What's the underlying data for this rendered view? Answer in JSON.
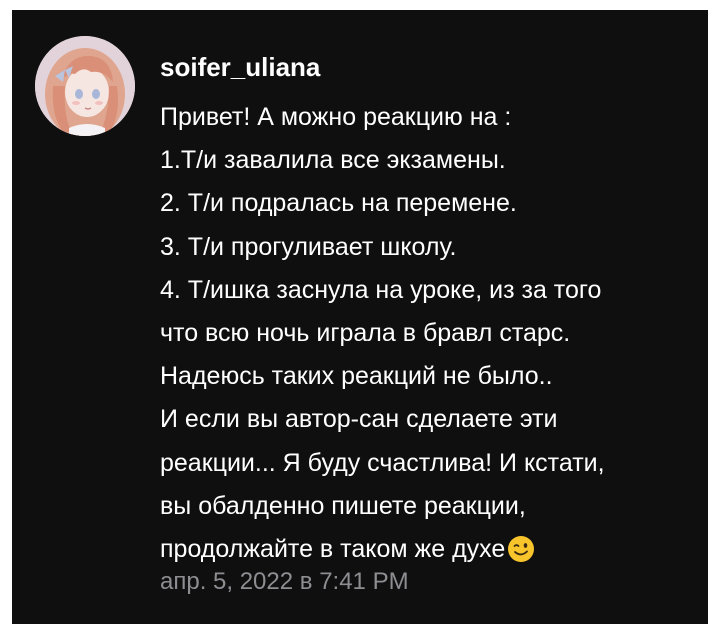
{
  "comment": {
    "username": "soifer_uliana",
    "avatar_icon": "user-avatar-anime-girl",
    "lines": [
      "Привет! А можно реакцию на :",
      "1.Т/и завалила все экзамены.",
      "2. Т/и подралась на перемене.",
      "3. Т/и прогуливает школу.",
      "4. Т/ишка заснула на уроке, из за того",
      "что всю ночь играла в бравл старс.",
      "Надеюсь таких реакций не было..",
      "И если вы автор-сан сделаете эти",
      "реакции... Я буду счастлива! И кстати,",
      "вы обалденно пишете реакции,",
      "продолжайте в таком же духе"
    ],
    "trailing_emoji": "winking-face-emoji",
    "timestamp": "апр. 5, 2022 в 7:41 PM"
  },
  "colors": {
    "card_background": "#0f0f10",
    "text": "#ffffff",
    "timestamp": "#8e8e92",
    "emoji": "#f7c52b"
  }
}
